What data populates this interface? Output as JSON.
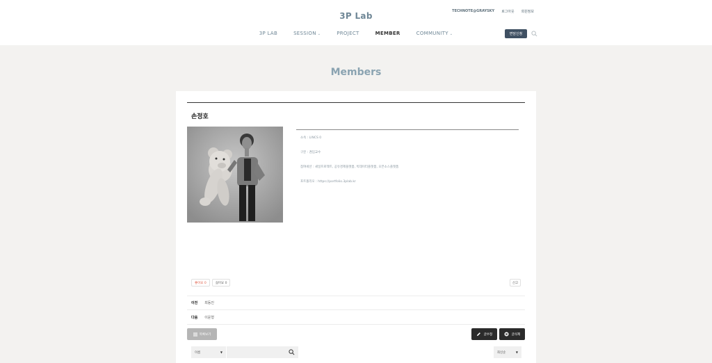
{
  "header": {
    "site_title": "3P Lab",
    "top_links": [
      "TECHNOTE@GRAYSKY",
      "로그아웃",
      "회원정보"
    ],
    "nav": [
      {
        "label": "3P LAB",
        "caret": false,
        "active": false
      },
      {
        "label": "SESSION",
        "caret": true,
        "active": false
      },
      {
        "label": "PROJECT",
        "caret": false,
        "active": false
      },
      {
        "label": "MEMBER",
        "caret": false,
        "active": true
      },
      {
        "label": "COMMUNITY",
        "caret": true,
        "active": false
      }
    ],
    "caret_glyph": "⌄",
    "apply_button": "면담신청"
  },
  "page": {
    "title": "Members"
  },
  "member": {
    "name": "손정호",
    "info": [
      "소속 : LINCS 0",
      "구분 : 겸임교수",
      "참여세션 : 새일프로젝트, 공유경제플랫폼, 빅데이터플랫폼, 오픈소스플랫폼",
      "포트폴리오 : https://portfolio.3plab.kr"
    ]
  },
  "reactions": {
    "like": "좋아요 0",
    "dislike": "싫어요 0",
    "all": "신고"
  },
  "prev_next": {
    "prev_label": "이전",
    "prev_value": "최동진",
    "next_label": "다음",
    "next_value": "이윤형"
  },
  "actions": {
    "list": "목록보기",
    "edit": "글수정",
    "delete": "글삭제"
  },
  "search": {
    "field_select": "이름",
    "sort_select": "최신순"
  },
  "colors": {
    "accent": "#6f8796",
    "button_dark": "#3f5062",
    "like": "#e0604b"
  }
}
